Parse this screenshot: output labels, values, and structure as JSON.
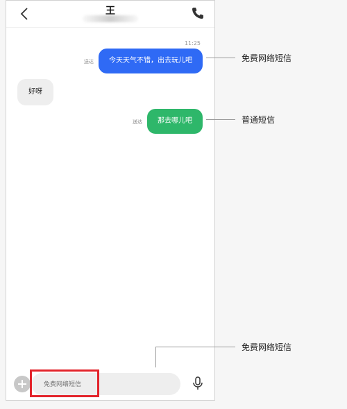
{
  "header": {
    "title": "王"
  },
  "messages": {
    "timestamp": "11:25",
    "items": [
      {
        "text": "今天天气不错，出去玩儿吧",
        "status": "送达",
        "color": "#2f6af5"
      },
      {
        "text": "好呀"
      },
      {
        "text": "那去哪儿吧",
        "status": "送达",
        "color": "#2eb76a"
      }
    ]
  },
  "input": {
    "placeholder": "免费网络短信"
  },
  "annotations": {
    "first": "免费网络短信",
    "second": "普通短信",
    "third": "免费网络短信"
  },
  "colors": {
    "highlight": "#e3242b"
  }
}
